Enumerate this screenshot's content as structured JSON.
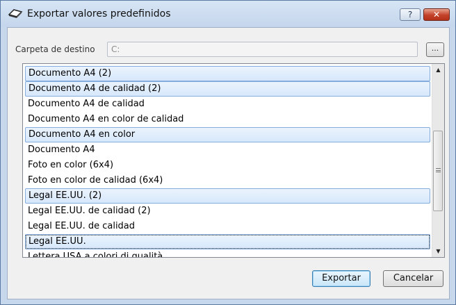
{
  "window": {
    "title": "Exportar valores predefinidos",
    "help_label": "?",
    "close_label": "✕"
  },
  "destination": {
    "label": "Carpeta de destino",
    "value": "C:",
    "browse_label": "..."
  },
  "presets": {
    "items": [
      {
        "label": "Documento A4 (2)",
        "selected": true
      },
      {
        "label": "Documento A4 de calidad (2)",
        "selected": true
      },
      {
        "label": "Documento A4 de calidad",
        "selected": false
      },
      {
        "label": "Documento A4 en color de calidad",
        "selected": false
      },
      {
        "label": "Documento A4 en color",
        "selected": true
      },
      {
        "label": "Documento A4",
        "selected": false
      },
      {
        "label": "Foto en color (6x4)",
        "selected": false
      },
      {
        "label": "Foto en color de calidad (6x4)",
        "selected": false
      },
      {
        "label": "Legal EE.UU. (2)",
        "selected": true
      },
      {
        "label": "Legal EE.UU. de calidad (2)",
        "selected": false
      },
      {
        "label": "Legal EE.UU. de calidad",
        "selected": false
      },
      {
        "label": "Legal EE.UU.",
        "selected": true,
        "focused": true
      },
      {
        "label": "Lettera USA a colori di qualità",
        "selected": false
      }
    ]
  },
  "buttons": {
    "export_label": "Exportar",
    "cancel_label": "Cancelar"
  },
  "icons": {
    "app": "scanner-icon",
    "scroll_up": "arrow-up-icon",
    "scroll_down": "arrow-down-icon"
  },
  "colors": {
    "selection_fill": "#d7e8fb",
    "selection_border": "#84acdd",
    "close_button": "#c4412a",
    "titlebar": "#c7d8ec"
  }
}
